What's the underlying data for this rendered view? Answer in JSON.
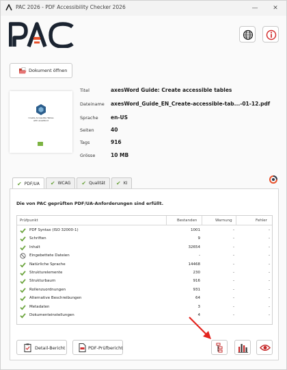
{
  "window": {
    "title": "PAC 2026 - PDF Accessibility Checker 2026",
    "minimize_icon": "minimize-icon",
    "close_icon": "close-icon"
  },
  "header": {
    "logo_text": "PAC",
    "globe_icon": "globe-icon",
    "info_icon": "info-icon",
    "brand_color": "#1a2330",
    "accent_color": "#e8502a"
  },
  "open_button": {
    "label": "Dokument öffnen"
  },
  "thumbnail": {
    "line1": "Create Accessible Tables",
    "line2": "with axesWord"
  },
  "metadata": [
    {
      "label": "Titel",
      "value": "axesWord Guide: Create accessible tables"
    },
    {
      "label": "Dateiname",
      "value": "axesWord_Guide_EN_Create-accessible-tab...-01-12.pdf"
    },
    {
      "label": "Sprache",
      "value": "en-US"
    },
    {
      "label": "Seiten",
      "value": "40"
    },
    {
      "label": "Tags",
      "value": "916"
    },
    {
      "label": "Grösse",
      "value": "10 MB"
    }
  ],
  "tabs": [
    {
      "label": "PDF/UA",
      "active": true
    },
    {
      "label": "WCAG",
      "active": false
    },
    {
      "label": "Qualität",
      "active": false
    },
    {
      "label": "KI",
      "active": false
    }
  ],
  "result_message": "Die von PAC geprüften PDF/UA-Anforderungen sind erfüllt.",
  "table": {
    "headers": [
      "Prüfpunkt",
      "Bestanden",
      "Warnung",
      "Fehler"
    ],
    "rows": [
      {
        "status": "pass",
        "name": "PDF Syntax (ISO 32000-1)",
        "passed": "1001",
        "warn": "-",
        "err": "-"
      },
      {
        "status": "pass",
        "name": "Schriften",
        "passed": "9",
        "warn": "-",
        "err": "-"
      },
      {
        "status": "pass",
        "name": "Inhalt",
        "passed": "32654",
        "warn": "-",
        "err": "-"
      },
      {
        "status": "na",
        "name": "Eingebettete Dateien",
        "passed": "-",
        "warn": "-",
        "err": "-"
      },
      {
        "status": "pass",
        "name": "Natürliche Sprache",
        "passed": "14468",
        "warn": "-",
        "err": "-"
      },
      {
        "status": "pass",
        "name": "Strukturelemente",
        "passed": "230",
        "warn": "-",
        "err": "-"
      },
      {
        "status": "pass",
        "name": "Strukturbaum",
        "passed": "916",
        "warn": "-",
        "err": "-"
      },
      {
        "status": "pass",
        "name": "Rollenzuordnungen",
        "passed": "931",
        "warn": "-",
        "err": "-"
      },
      {
        "status": "pass",
        "name": "Alternative Beschreibungen",
        "passed": "64",
        "warn": "-",
        "err": "-"
      },
      {
        "status": "pass",
        "name": "Metadaten",
        "passed": "3",
        "warn": "-",
        "err": "-"
      },
      {
        "status": "pass",
        "name": "Dokumenteinstellungen",
        "passed": "4",
        "warn": "-",
        "err": "-"
      }
    ]
  },
  "footer": {
    "detail_report_label": "Detail-Bericht",
    "pdf_report_label": "PDF-Prüfbericht",
    "structure_icon": "structure-tree-icon",
    "chart_icon": "bar-chart-icon",
    "preview_icon": "eye-icon"
  },
  "colors": {
    "check_green": "#6aa33b",
    "arrow_red": "#e3231d"
  }
}
